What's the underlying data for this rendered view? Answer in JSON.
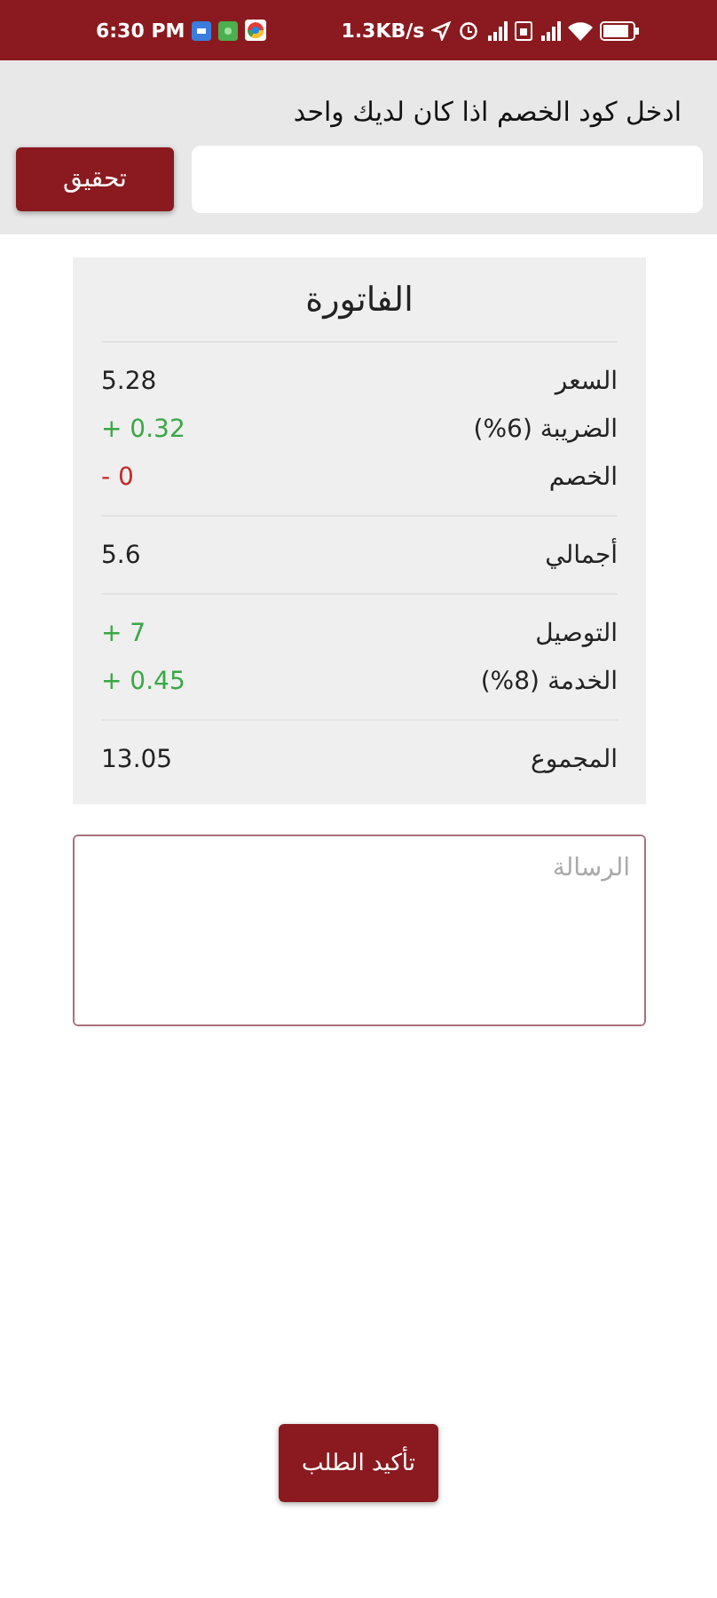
{
  "status_bar": {
    "time": "6:30 PM",
    "speed": "1.3KB/s"
  },
  "discount": {
    "prompt": "ادخل  كود الخصم اذا كان لديك واحد",
    "button": "تحقيق"
  },
  "invoice": {
    "title": "الفاتورة",
    "groups": [
      {
        "rows": [
          {
            "label": "السعر",
            "value": "5.28",
            "kind": "plain"
          },
          {
            "label": "الضريبة (6%)",
            "value": "+ 0.32",
            "kind": "add"
          },
          {
            "label": "الخصم",
            "value": "- 0",
            "kind": "subtract"
          }
        ]
      },
      {
        "rows": [
          {
            "label": "أجمالي",
            "value": "5.6",
            "kind": "plain"
          }
        ]
      },
      {
        "rows": [
          {
            "label": "التوصيل",
            "value": "+ 7",
            "kind": "add"
          },
          {
            "label": "الخدمة (8%)",
            "value": "+ 0.45",
            "kind": "add"
          }
        ]
      },
      {
        "rows": [
          {
            "label": "المجموع",
            "value": "13.05",
            "kind": "plain"
          }
        ]
      }
    ]
  },
  "message": {
    "placeholder": "الرسالة"
  },
  "confirm_button": "تأكيد الطلب"
}
